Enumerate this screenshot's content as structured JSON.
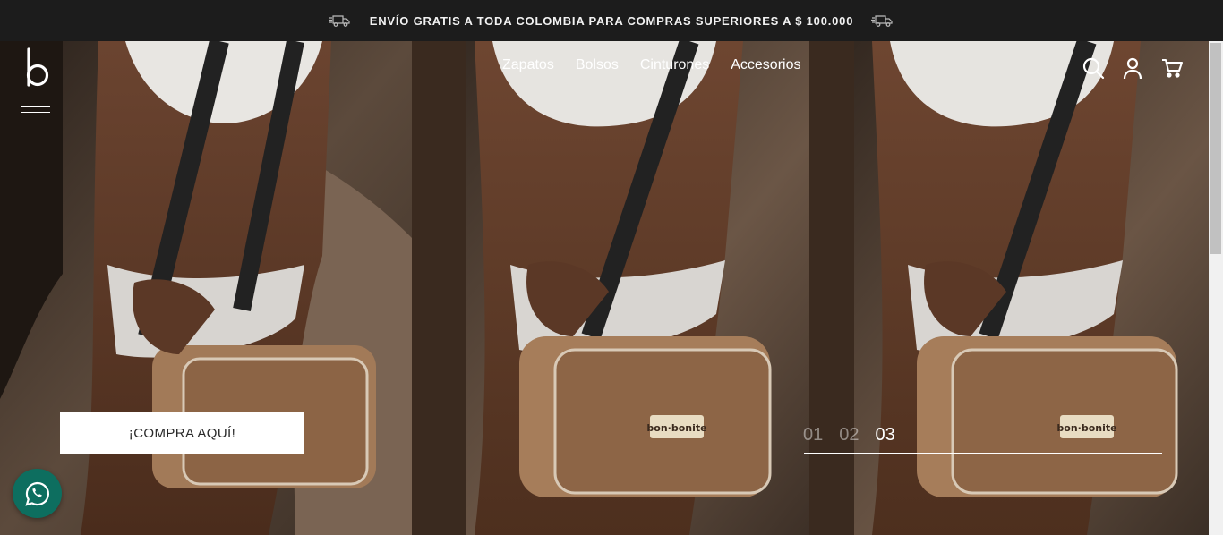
{
  "announcement": {
    "text": "ENVÍO GRATIS A TODA COLOMBIA PARA COMPRAS SUPERIORES A $ 100.000",
    "left_icon": "truck-icon",
    "right_icon": "truck-icon"
  },
  "header": {
    "logo_icon": "brand-b-logo",
    "menu_icon": "hamburger-icon",
    "nav": [
      {
        "label": "Zapatos"
      },
      {
        "label": "Bolsos"
      },
      {
        "label": "Cinturones"
      },
      {
        "label": "Accesorios"
      }
    ],
    "icons": [
      "search-icon",
      "account-icon",
      "cart-icon"
    ]
  },
  "hero": {
    "cta_label": "¡COMPRA AQUÍ!",
    "bag_label": "bon·bonite",
    "slides": [
      "01",
      "02",
      "03"
    ],
    "active_slide": "03"
  },
  "whatsapp": {
    "icon": "whatsapp-icon",
    "color": "#0d6e5f"
  }
}
